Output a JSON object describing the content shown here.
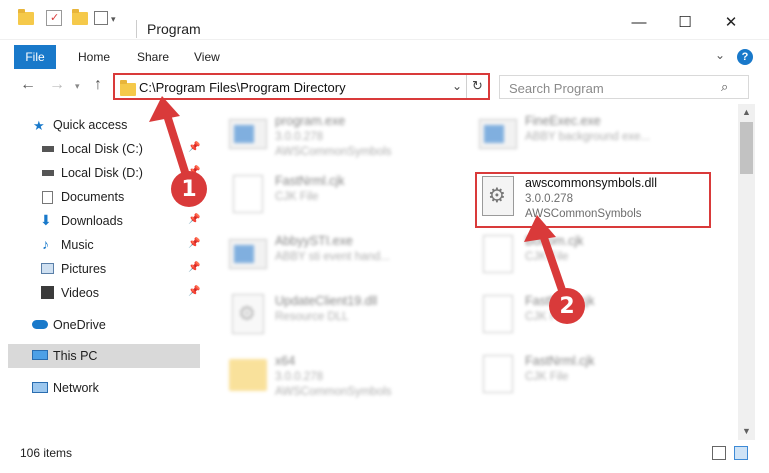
{
  "window": {
    "title": "Program",
    "minimize": "—",
    "maximize": "☐",
    "close": "✕"
  },
  "ribbon": {
    "file": "File",
    "tabs": [
      "Home",
      "Share",
      "View"
    ],
    "help": "?"
  },
  "address": {
    "path": "C:\\Program Files\\Program Directory"
  },
  "search": {
    "placeholder": "Search Program"
  },
  "sidebar": {
    "items": [
      {
        "label": "Quick access",
        "icon": "star-icon"
      },
      {
        "label": "Local Disk (C:)",
        "icon": "drive-icon",
        "pinned": true
      },
      {
        "label": "Local Disk (D:)",
        "icon": "drive-icon",
        "pinned": true
      },
      {
        "label": "Documents",
        "icon": "documents-icon",
        "pinned": true
      },
      {
        "label": "Downloads",
        "icon": "downloads-icon",
        "pinned": true
      },
      {
        "label": "Music",
        "icon": "music-icon",
        "pinned": true
      },
      {
        "label": "Pictures",
        "icon": "pictures-icon",
        "pinned": true
      },
      {
        "label": "Videos",
        "icon": "videos-icon",
        "pinned": true
      },
      {
        "label": "OneDrive",
        "icon": "cloud-icon"
      },
      {
        "label": "This PC",
        "icon": "computer-icon",
        "selected": true
      },
      {
        "label": "Network",
        "icon": "network-icon"
      }
    ]
  },
  "files": [
    {
      "name": "program.exe",
      "line2": "3.0.0.278",
      "line3": "AWSCommonSymbols",
      "icon": "exe-icon"
    },
    {
      "name": "FineExec.exe",
      "line2": "ABBY background exe...",
      "line3": "",
      "icon": "exe-icon"
    },
    {
      "name": "FastNrml.cjk",
      "line2": "CJK File",
      "line3": "",
      "icon": "document-icon"
    },
    {
      "name": "awscommonsymbols.dll",
      "line2": "3.0.0.278",
      "line3": "AWSCommonSymbols",
      "icon": "dll-gear-icon",
      "highlighted": true
    },
    {
      "name": "AbbyySTI.exe",
      "line2": "ABBY sti event hand...",
      "line3": "",
      "icon": "exe-icon"
    },
    {
      "name": "Bottom.cjk",
      "line2": "CJK File",
      "line3": "",
      "icon": "document-icon"
    },
    {
      "name": "UpdateClient19.dll",
      "line2": "Resource DLL",
      "line3": "",
      "icon": "dll-gear-icon"
    },
    {
      "name": "FastNrml.cjk",
      "line2": "CJK File",
      "line3": "",
      "icon": "document-icon"
    },
    {
      "name": "x64",
      "line2": "3.0.0.278",
      "line3": "AWSCommonSymbols",
      "icon": "folder-icon"
    },
    {
      "name": "FastNrml.cjk",
      "line2": "CJK File",
      "line3": "",
      "icon": "document-icon"
    }
  ],
  "status": {
    "items": "106 items"
  },
  "annotations": {
    "step1": "1",
    "step2": "2",
    "color": "#d93a3a"
  },
  "colors": {
    "accent": "#1979ca",
    "highlight": "#d93a3a"
  }
}
